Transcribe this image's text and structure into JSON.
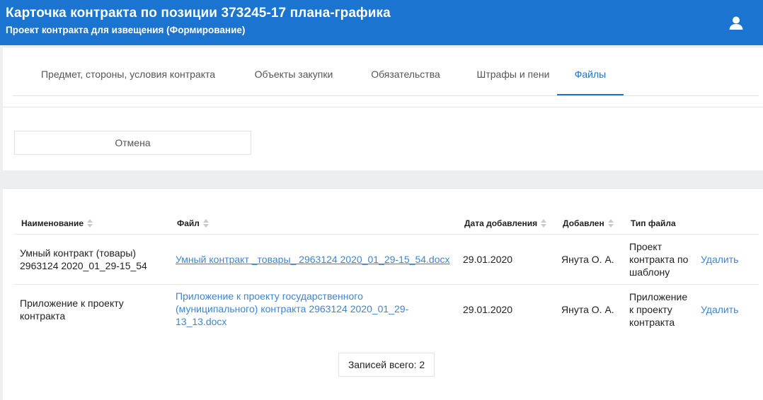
{
  "header": {
    "title": "Карточка контракта по позиции 373245-17 плана-графика",
    "subtitle": "Проект контракта для извещения (Формирование)"
  },
  "tabs": [
    {
      "label": "Предмет, стороны, условия контракта"
    },
    {
      "label": "Объекты закупки"
    },
    {
      "label": "Обязательства"
    },
    {
      "label": "Штрафы и пени"
    },
    {
      "label": "Файлы",
      "active": true
    }
  ],
  "actions": {
    "cancel_label": "Отмена"
  },
  "table": {
    "columns": [
      "Наименование",
      "Файл",
      "Дата добавления",
      "Добавлен",
      "Тип файла"
    ],
    "rows": [
      {
        "name": "Умный контракт (товары) 2963124 2020_01_29-15_54",
        "file": "Умный контракт _товары_ 2963124 2020_01_29-15_54.docx",
        "date": "29.01.2020",
        "added_by": "Янута О. А.",
        "type": "Проект контракта по шаблону",
        "delete_label": "Удалить"
      },
      {
        "name": "Приложение к проекту контракта",
        "file": "Приложение к проекту государственного (муниципального) контракта 2963124 2020_01_29-13_13.docx",
        "date": "29.01.2020",
        "added_by": "Янута О. А.",
        "type": "Приложение к проекту контракта",
        "delete_label": "Удалить"
      }
    ]
  },
  "footer": {
    "total_label": "Записей всего: 2"
  },
  "colors": {
    "header_bg": "#1b75d0",
    "link": "#3f84d1",
    "page_bg": "#eceef1"
  },
  "icons": {
    "user": "user-icon",
    "sort": "sort-icon"
  }
}
